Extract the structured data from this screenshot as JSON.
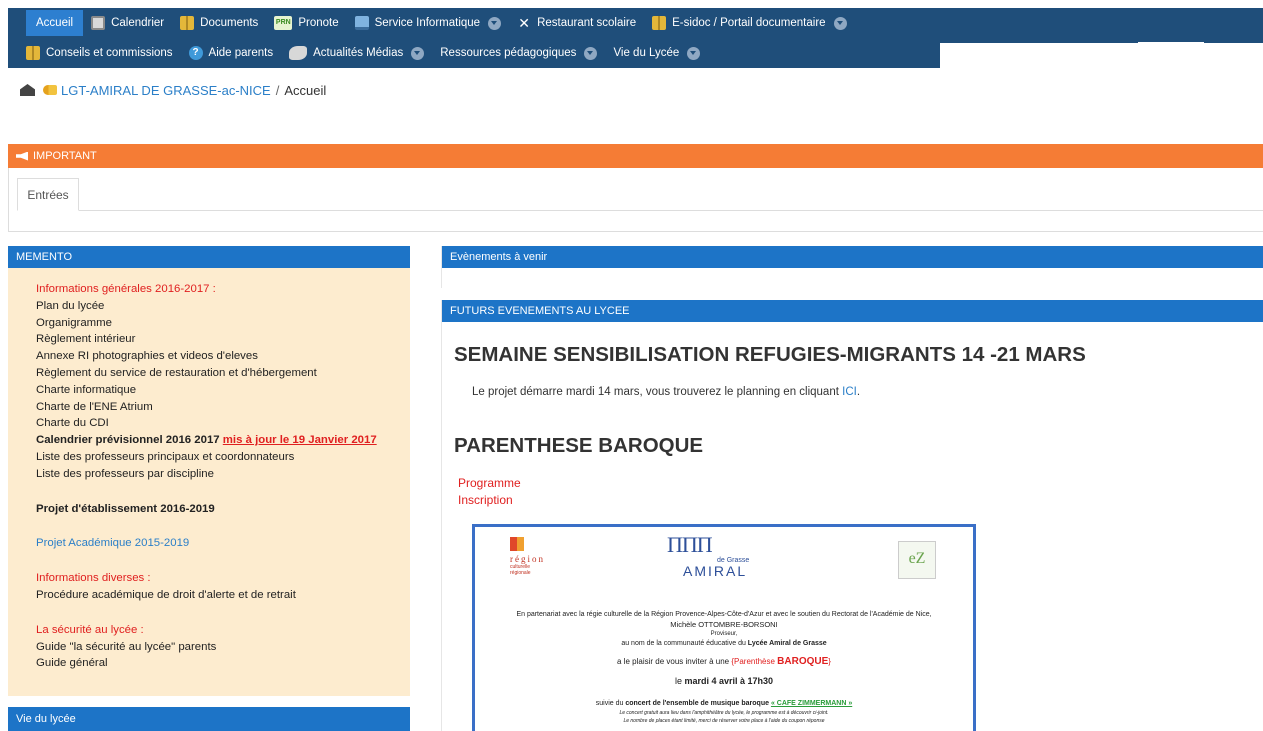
{
  "nav": {
    "row1": [
      {
        "label": "Accueil"
      },
      {
        "label": "Calendrier"
      },
      {
        "label": "Documents"
      },
      {
        "label": "Pronote",
        "icon_text": "PRN"
      },
      {
        "label": "Service Informatique"
      },
      {
        "label": "Restaurant scolaire"
      },
      {
        "label": "E-sidoc / Portail documentaire"
      }
    ],
    "row2": [
      {
        "label": "Conseils et commissions"
      },
      {
        "label": "Aide parents",
        "icon_text": "?"
      },
      {
        "label": "Actualités Médias"
      },
      {
        "label": "Ressources pédagogiques"
      },
      {
        "label": "Vie du Lycée"
      }
    ]
  },
  "breadcrumb": {
    "site": "LGT-AMIRAL DE GRASSE-ac-NICE",
    "separator": "/",
    "current": "Accueil"
  },
  "important": {
    "title": "IMPORTANT",
    "tab": "Entrées"
  },
  "memento": {
    "title": "MEMENTO",
    "items": [
      "Informations générales 2016-2017 :",
      "Plan du lycée",
      "Organigramme",
      "Règlement intérieur",
      "Annexe RI photographies et videos d'eleves",
      "Règlement du service de restauration et d'hébergement",
      "Charte informatique",
      "Charte de l'ENE Atrium",
      "Charte du CDI",
      "Calendrier prévisionnel 2016 2017",
      "mis à jour le  19 Janvier 2017",
      "Liste des professeurs principaux et coordonnateurs",
      "Liste des professeurs par discipline",
      "Projet d'établissement 2016-2019",
      "Projet Académique 2015-2019",
      "Informations diverses :",
      "Procédure académique de droit d'alerte et de retrait",
      "La sécurité au lycée :",
      "Guide \"la sécurité au lycée\" parents",
      "Guide général"
    ]
  },
  "vie_lycee": {
    "title": "Vie du lycée"
  },
  "events": {
    "title": "Evènements à venir"
  },
  "futurs": {
    "title": "FUTURS EVENEMENTS AU LYCEE",
    "heading1": "SEMAINE SENSIBILISATION REFUGIES-MIGRANTS 14 -21 MARS",
    "para_text": "Le projet démarre mardi 14 mars, vous trouverez le planning en cliquant ",
    "para_link": "ICI",
    "para_end": ".",
    "heading2": "PARENTHESE BAROQUE",
    "link_programme": "Programme",
    "link_inscription": "Inscription"
  },
  "invitation": {
    "region_line1": "région",
    "region_line2": "culturelle",
    "region_line3": "régionale",
    "lycee_arches": "ΠΠΠ",
    "lycee_grasse": "de Grasse",
    "lycee_amiral": "AMIRAL",
    "line1": "En partenariat avec la régie culturelle de la Région Provence-Alpes-Côte-d'Azur et avec le soutien du Rectorat de l'Académie de Nice,",
    "line2": "Michèle OTTOMBRE-BORSONI",
    "line3": "Proviseur,",
    "line4a": "au nom de la communauté éducative du ",
    "line4b": "Lycée Amiral de Grasse",
    "line5a": "a le plaisir de vous inviter  à une ",
    "line5b": "Parenthèse ",
    "line5c": "BAROQUE",
    "line6a": "le ",
    "line6b": "mardi 4 avril à 17h30",
    "line7a": "suivie du ",
    "line7b": "concert de l'ensemble de musique baroque",
    "line7c": "« CAFE ZIMMERMANN »",
    "line8": "Le concert gratuit aura lieu dans l'amphithéâtre du lycée, le programme est à découvrir ci-joint.",
    "line9": "Le nombre de places étant limité, merci de réserver votre place à l'aide du coupon réponse"
  },
  "colors": {
    "nav_bg": "#1f4e7a",
    "nav_active": "#2d7fd0",
    "important_bar": "#f57c35",
    "panel_head": "#1d74c7",
    "memento_bg": "#fdeccf",
    "link_blue": "#2b7fc8",
    "alert_red": "#e02020"
  },
  "icons": [
    "books-icon",
    "calendar-icon",
    "pronote-icon",
    "monitor-icon",
    "cutlery-icon",
    "help-icon",
    "media-icon",
    "chevron-down-icon",
    "home-icon",
    "key-icon",
    "megaphone-icon"
  ]
}
